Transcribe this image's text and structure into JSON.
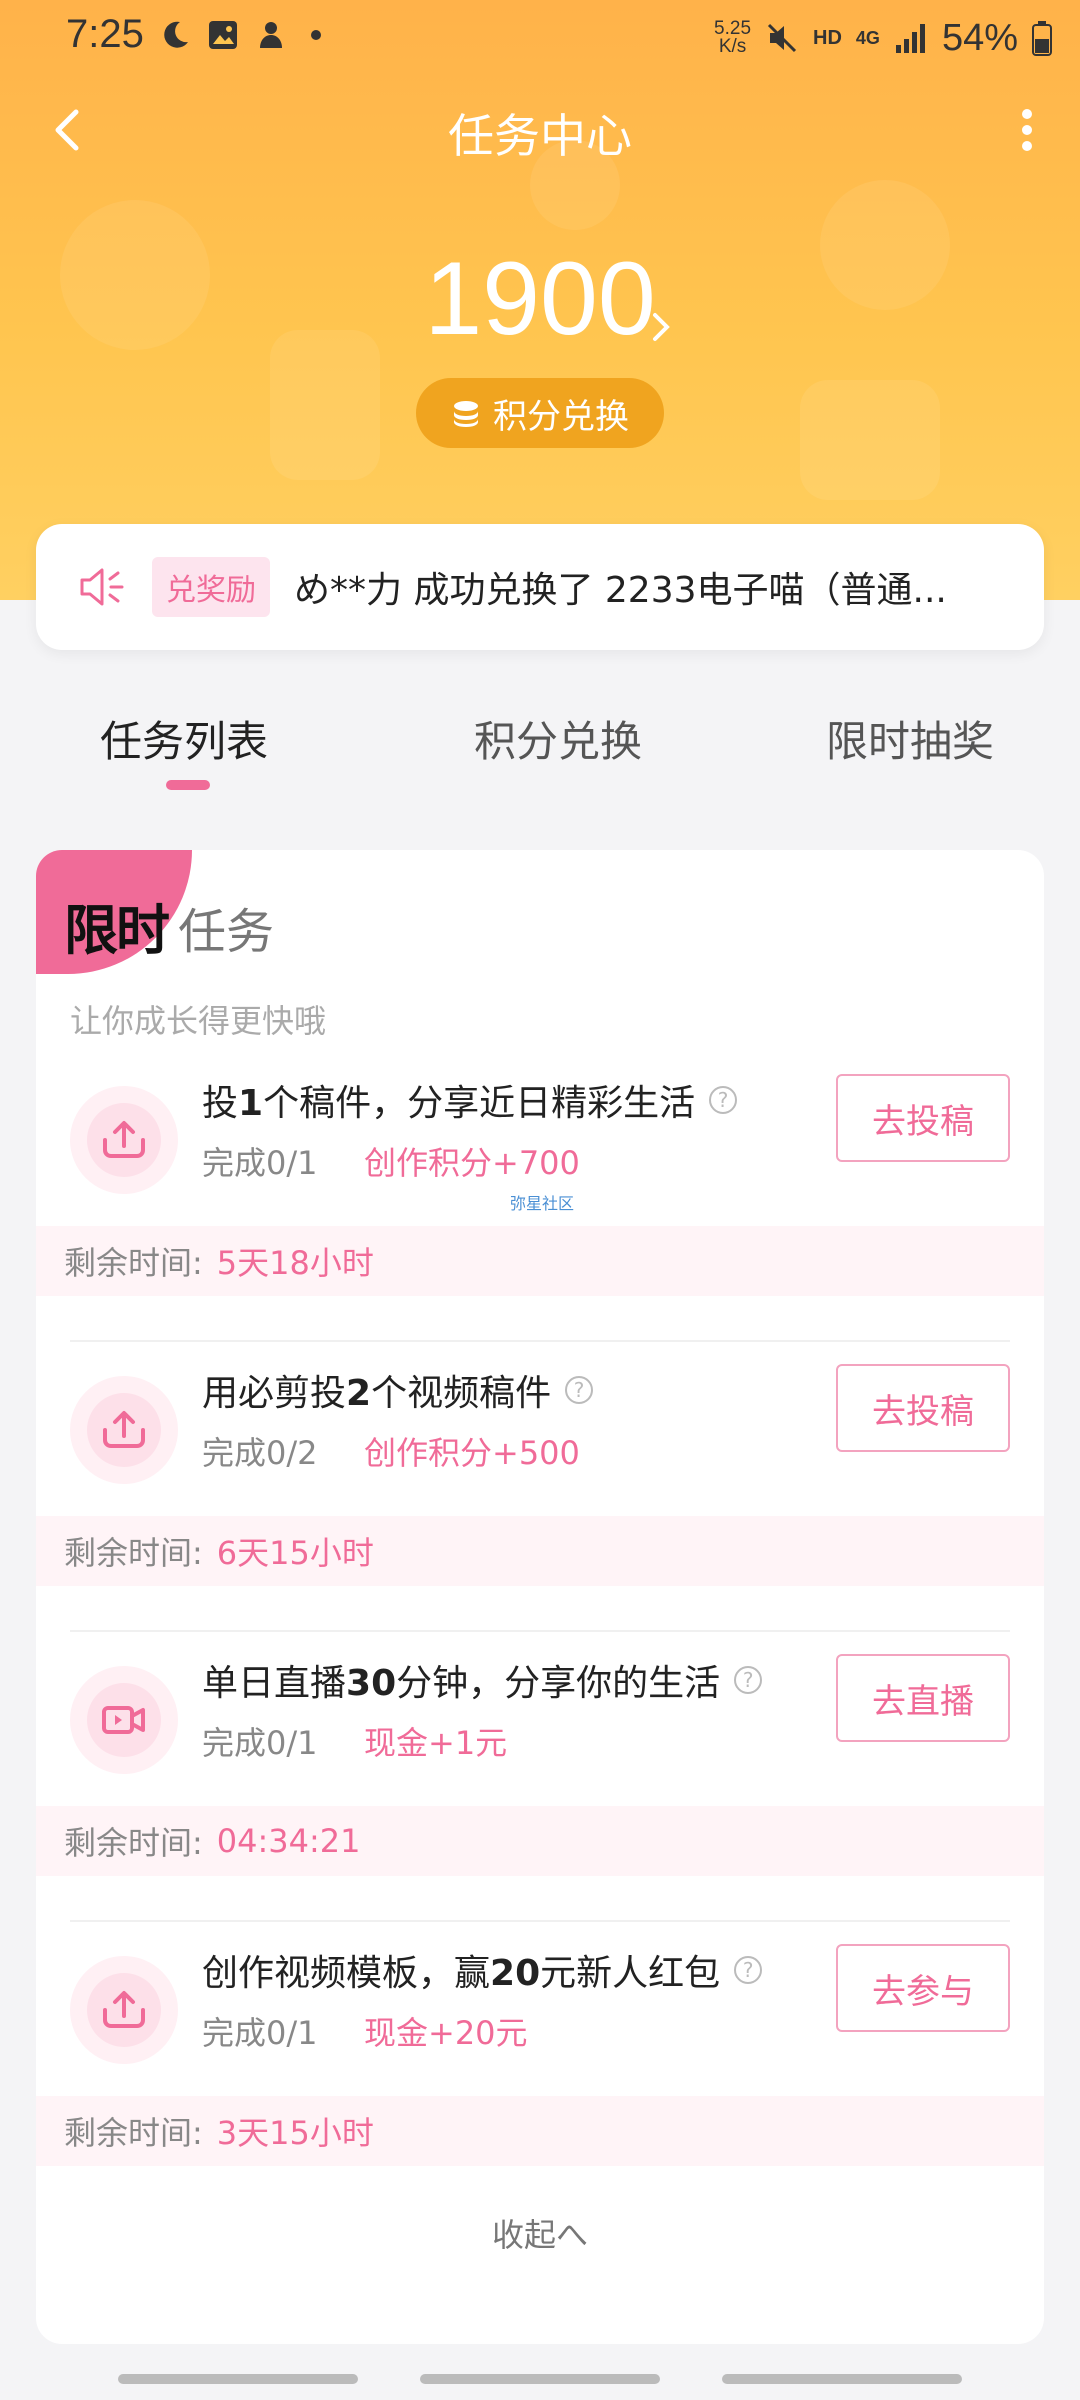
{
  "status_bar": {
    "time": "7:25",
    "speed_value": "5.25",
    "speed_unit": "K/s",
    "hd": "HD",
    "network": "4G",
    "battery": "54%"
  },
  "header": {
    "title": "任务中心",
    "points": "1900",
    "exchange_label": "积分兑换"
  },
  "notice": {
    "badge": "兑奖励",
    "text": "め**力 成功兑换了 2233电子喵（普通..."
  },
  "tabs": [
    "任务列表",
    "积分兑换",
    "限时抽奖"
  ],
  "limited": {
    "title_a": "限时",
    "title_b": "任务",
    "subtitle": "让你成长得更快哦",
    "watermark": "弥星社区"
  },
  "tasks": [
    {
      "title_pre": "投",
      "title_num": "1",
      "title_post": "个稿件，分享近日精彩生活",
      "progress": "完成0/1",
      "reward": "创作积分+700",
      "button": "去投稿",
      "time_label": "剩余时间:",
      "time_value": "5天18小时",
      "icon": "upload-icon"
    },
    {
      "title_pre": "用必剪投",
      "title_num": "2",
      "title_post": "个视频稿件",
      "progress": "完成0/2",
      "reward": "创作积分+500",
      "button": "去投稿",
      "time_label": "剩余时间:",
      "time_value": "6天15小时",
      "icon": "upload-icon"
    },
    {
      "title_pre": "单日直播",
      "title_num": "30",
      "title_post": "分钟，分享你的生活",
      "progress": "完成0/1",
      "reward": "现金+1元",
      "button": "去直播",
      "time_label": "剩余时间:",
      "time_value": "04:34:21",
      "icon": "video-camera-icon"
    },
    {
      "title_pre": "创作视频模板，赢",
      "title_num": "20",
      "title_post": "元新人红包",
      "progress": "完成0/1",
      "reward": "现金+20元",
      "button": "去参与",
      "time_label": "剩余时间:",
      "time_value": "3天15小时",
      "icon": "upload-icon"
    }
  ],
  "collapse_label": "收起へ",
  "colors": {
    "accent": "#f06b98",
    "header_bg": "#ffb24a",
    "pill_bg": "#f0a41f"
  }
}
